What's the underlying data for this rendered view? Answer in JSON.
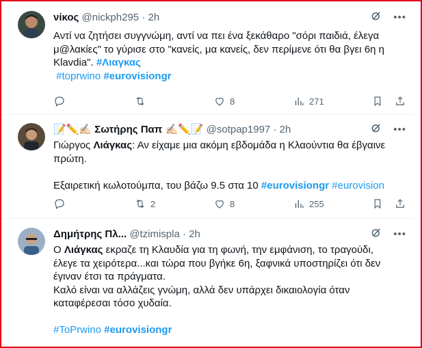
{
  "tweets": [
    {
      "name": "νίκος",
      "handle": "@nickph295",
      "sep": "·",
      "time": "2h",
      "lines": [
        "Αντί να ζητήσει συγγνώμη, αντί να πει ένα ξεκάθαρο \"σόρι παιδιά, έλεγα",
        "μ@λακίες\" το γύρισε στο \"κανείς, μα κανείς, δεν περίμενε ότι θα βγει 6η η",
        "Klavdia\"."
      ],
      "inline_tag": "#Λιαγκας",
      "tags": [
        "#toprwino",
        "#eurovisiongr"
      ],
      "likes": "8",
      "views": "271"
    },
    {
      "name_prefix": "📝✏️✍🏻",
      "name": "Σωτήρης Παπ",
      "name_suffix": "✍🏻✏️📝",
      "handle": "@sotpap1997",
      "sep": "·",
      "time": "2h",
      "line1_pre": "Γιώργος ",
      "line1_bold": "Λιάγκας",
      "line1_post": ": Αν είχαμε μια ακόμη εβδομάδα η Κλαούντια θα έβγαινε",
      "line2": "πρώτη.",
      "line3": "Εξαιρετική κωλοτούμπα, του βάζω 9.5 στα 10",
      "tag_bold": "#eurovisiongr",
      "tag_plain": "#eurovision",
      "retweets": "2",
      "likes": "8",
      "views": "255"
    },
    {
      "name": "Δημήτρης Πλ...",
      "handle": "@tzimispla",
      "sep": "·",
      "time": "2h",
      "line1_pre": "Ο ",
      "line1_bold": "Λιάγκας",
      "line1_post": " εκραζε τη Κλαυδία για τη φωνή, την εμφάνιση, το τραγούδι,",
      "line2": "έλεγε τα χειρότερα...και τώρα που βγήκε 6η, ξαφνικά υποστηρίζει ότι δεν",
      "line3": "έγιναν έτσι τα πράγματα.",
      "line4": "Καλό είναι να αλλάζεις γνώμη, αλλά δεν υπάρχει δικαιολογία όταν",
      "line5": "καταφέρεσαι τόσο χυδαία.",
      "tags": [
        "#ToPrwino",
        "#eurovisiongr"
      ]
    }
  ],
  "icons": [
    "grok-icon",
    "more-icon",
    "reply-icon",
    "retweet-icon",
    "like-icon",
    "views-icon"
  ],
  "colors": {
    "link": "#1d9bf0",
    "muted": "#536471",
    "border": "#e0001a"
  }
}
